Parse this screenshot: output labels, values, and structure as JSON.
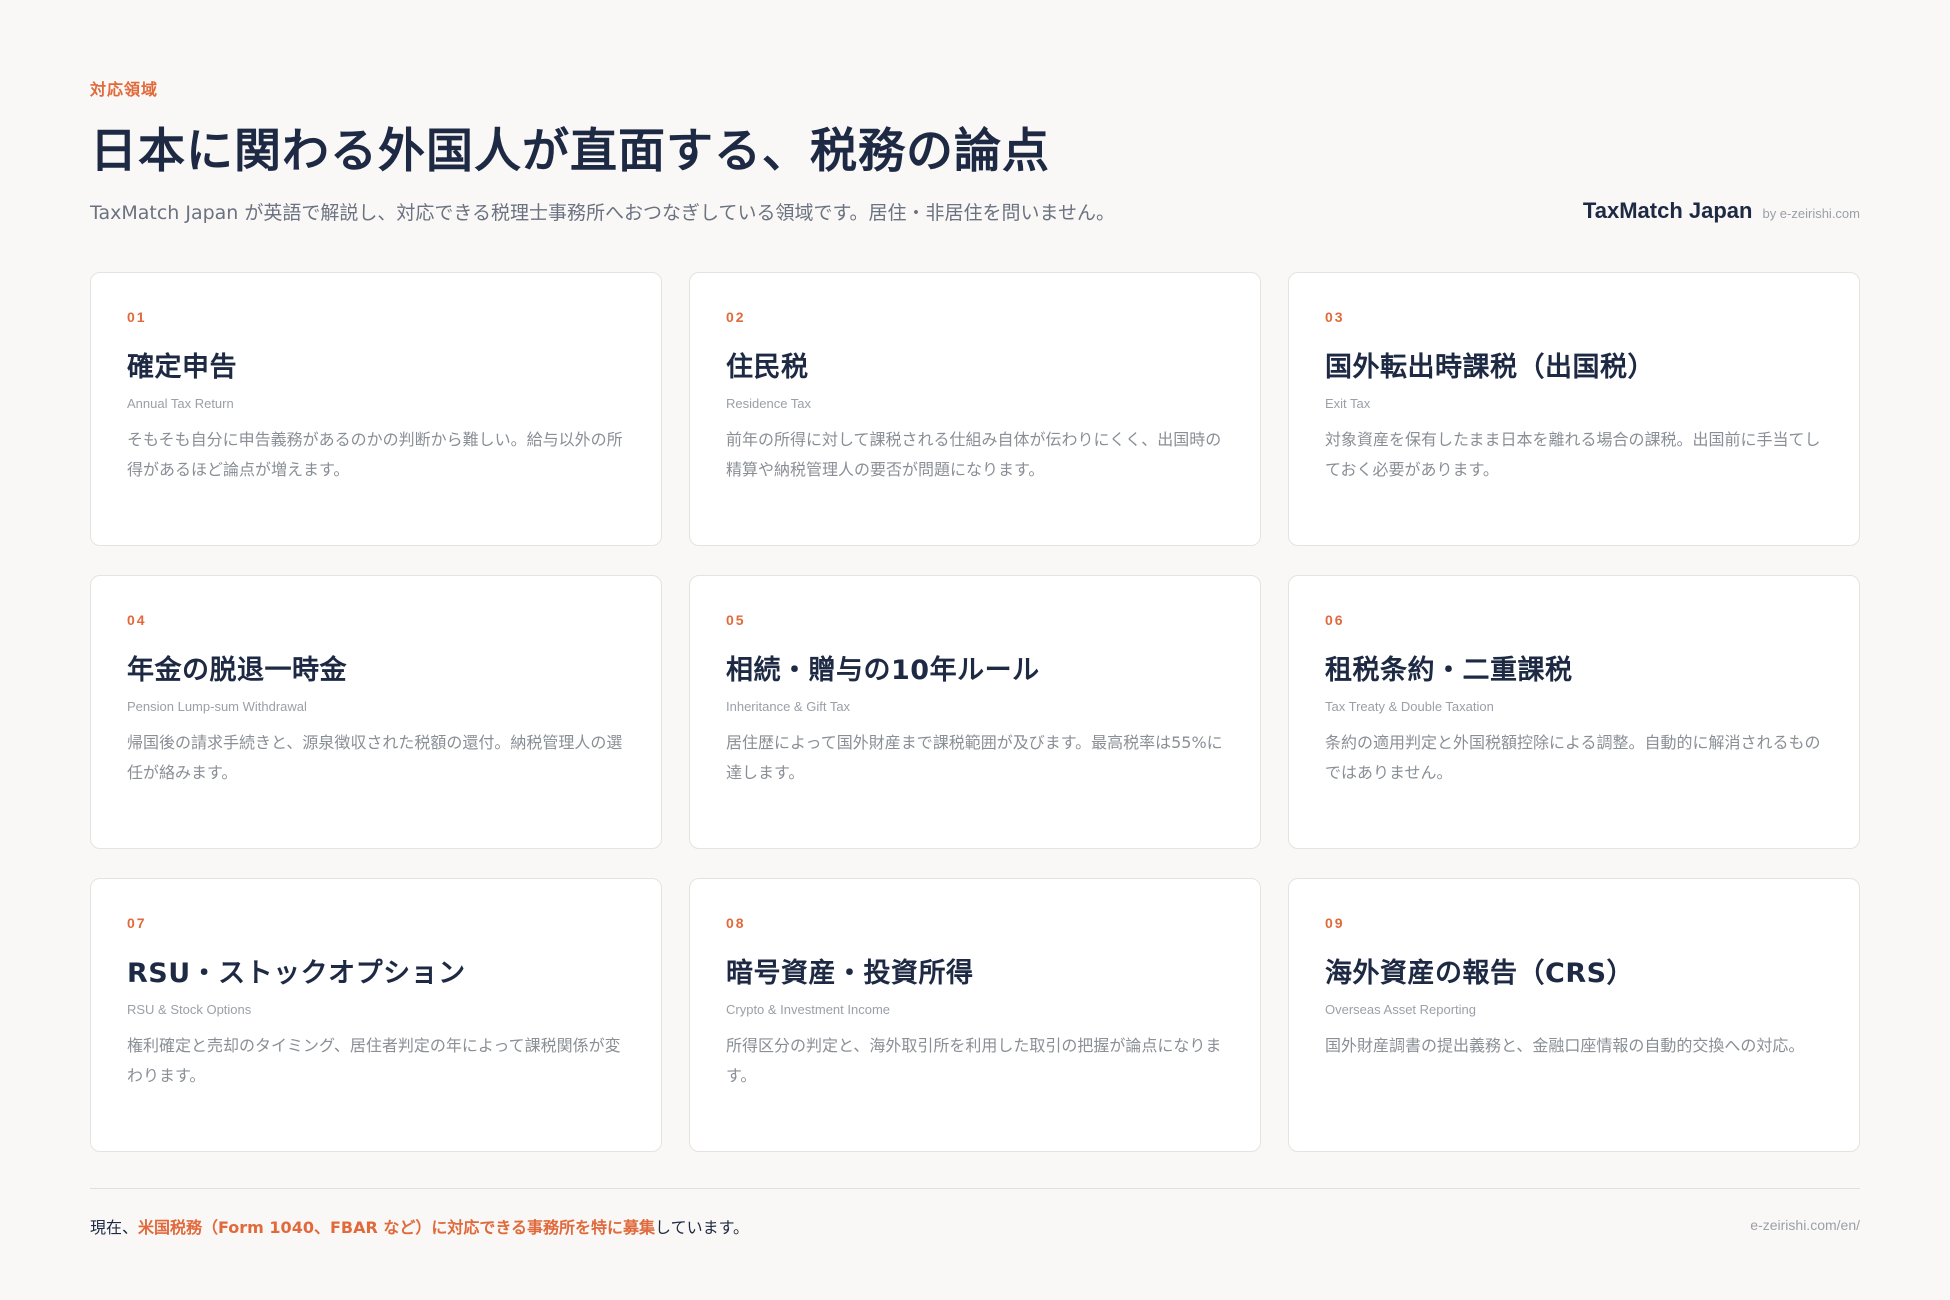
{
  "header": {
    "eyebrow": "対応領域",
    "title": "日本に関わる外国人が直面する、税務の論点",
    "subtitle": "TaxMatch Japan が英語で解説し、対応できる税理士事務所へおつなぎしている領域です。居住・非居住を問いません。",
    "brand_name": "TaxMatch Japan",
    "brand_by": "by e-zeirishi.com"
  },
  "cards": [
    {
      "num": "01",
      "title": "確定申告",
      "en": "Annual Tax Return",
      "desc": "そもそも自分に申告義務があるのかの判断から難しい。給与以外の所得があるほど論点が増えます。"
    },
    {
      "num": "02",
      "title": "住民税",
      "en": "Residence Tax",
      "desc": "前年の所得に対して課税される仕組み自体が伝わりにくく、出国時の精算や納税管理人の要否が問題になります。"
    },
    {
      "num": "03",
      "title": "国外転出時課税（出国税）",
      "en": "Exit Tax",
      "desc": "対象資産を保有したまま日本を離れる場合の課税。出国前に手当てしておく必要があります。"
    },
    {
      "num": "04",
      "title": "年金の脱退一時金",
      "en": "Pension Lump-sum Withdrawal",
      "desc": "帰国後の請求手続きと、源泉徴収された税額の還付。納税管理人の選任が絡みます。"
    },
    {
      "num": "05",
      "title": "相続・贈与の10年ルール",
      "en": "Inheritance & Gift Tax",
      "desc": "居住歴によって国外財産まで課税範囲が及びます。最高税率は55%に達します。"
    },
    {
      "num": "06",
      "title": "租税条約・二重課税",
      "en": "Tax Treaty & Double Taxation",
      "desc": "条約の適用判定と外国税額控除による調整。自動的に解消されるものではありません。"
    },
    {
      "num": "07",
      "title": "RSU・ストックオプション",
      "en": "RSU & Stock Options",
      "desc": "権利確定と売却のタイミング、居住者判定の年によって課税関係が変わります。"
    },
    {
      "num": "08",
      "title": "暗号資産・投資所得",
      "en": "Crypto & Investment Income",
      "desc": "所得区分の判定と、海外取引所を利用した取引の把握が論点になります。"
    },
    {
      "num": "09",
      "title": "海外資産の報告（CRS）",
      "en": "Overseas Asset Reporting",
      "desc": "国外財産調書の提出義務と、金融口座情報の自動的交換への対応。"
    }
  ],
  "footer": {
    "prefix": "現在、",
    "highlight": "米国税務（Form 1040、FBAR など）に対応できる事務所を特に募集",
    "suffix": "しています。",
    "url": "e-zeirishi.com/en/"
  },
  "colors": {
    "accent": "#e06a3c",
    "navy": "#1e2a44",
    "background": "#f9f8f6"
  }
}
